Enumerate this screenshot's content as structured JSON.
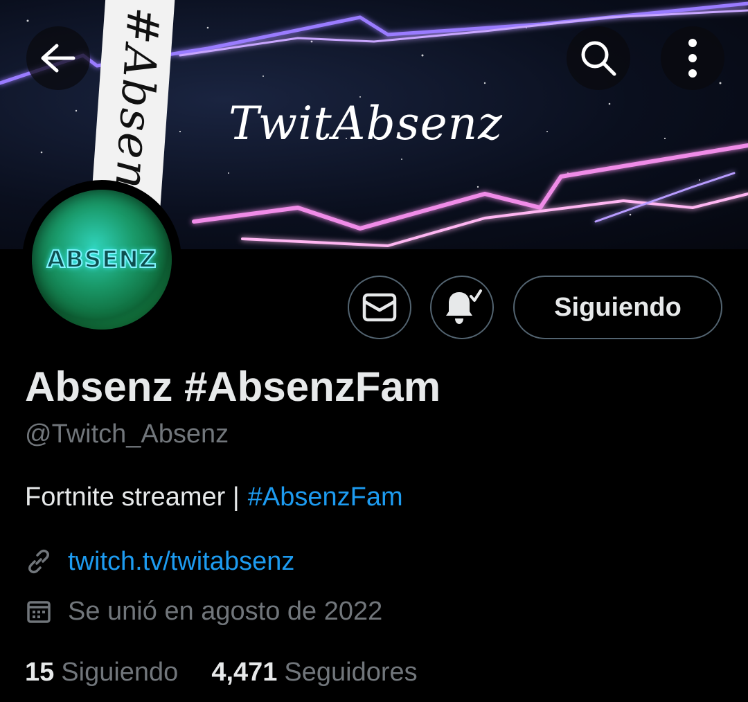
{
  "banner": {
    "title": "TwitAbsenz",
    "side_tag": "#AbsenzF"
  },
  "nav": {
    "back_icon": "arrow-left-icon",
    "search_icon": "search-icon",
    "more_icon": "more-vertical-icon"
  },
  "avatar": {
    "text": "ABSENZ"
  },
  "actions": {
    "message_icon": "envelope-icon",
    "notify_icon": "bell-check-icon",
    "follow_label": "Siguiendo"
  },
  "profile": {
    "display_name": "Absenz #AbsenzFam",
    "handle": "@Twitch_Absenz",
    "bio_text": "Fortnite streamer |",
    "bio_hashtag": "#AbsenzFam",
    "website": "twitch.tv/twitabsenz",
    "joined": "Se unió en agosto de 2022"
  },
  "stats": {
    "following_count": "15",
    "following_label": "Siguiendo",
    "followers_count": "4,471",
    "followers_label": "Seguidores"
  },
  "colors": {
    "background": "#000000",
    "primary_text": "#e7e9ea",
    "secondary_text": "#71767b",
    "accent": "#1d9bf0",
    "border": "#536471"
  }
}
